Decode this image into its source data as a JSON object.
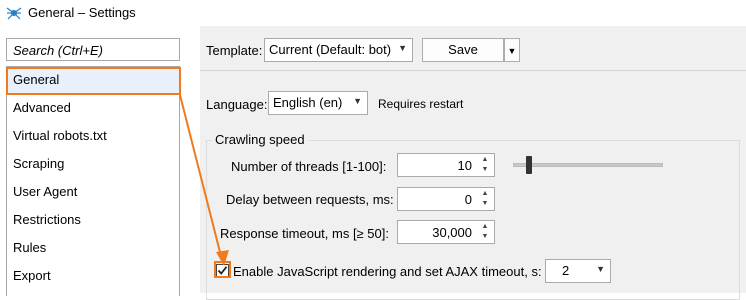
{
  "window": {
    "title": "General – Settings",
    "icon": "spider-icon"
  },
  "sidebar": {
    "search_placeholder": "Search (Ctrl+E)",
    "items": [
      {
        "label": "General",
        "selected": true
      },
      {
        "label": "Advanced"
      },
      {
        "label": "Virtual robots.txt"
      },
      {
        "label": "Scraping"
      },
      {
        "label": "User Agent"
      },
      {
        "label": "Restrictions"
      },
      {
        "label": "Rules"
      },
      {
        "label": "Export"
      }
    ]
  },
  "toolbar": {
    "template_label": "Template:",
    "template_value": "Current (Default: bot)",
    "save_label": "Save"
  },
  "language": {
    "label": "Language:",
    "value": "English (en)",
    "note": "Requires restart"
  },
  "crawling": {
    "group_title": "Crawling speed",
    "threads_label": "Number of threads [1-100]:",
    "threads_value": "10",
    "threads_slider_fraction": 0.1,
    "delay_label": "Delay between requests, ms:",
    "delay_value": "0",
    "timeout_label": "Response timeout, ms [≥ 50]:",
    "timeout_value": "30,000",
    "js_label": "Enable JavaScript rendering and set AJAX timeout, s:",
    "js_checked": true,
    "ajax_timeout_value": "2"
  },
  "colors": {
    "highlight": "#f07a1c",
    "selection": "#e8f1fb",
    "panel": "#f0f0f0"
  }
}
